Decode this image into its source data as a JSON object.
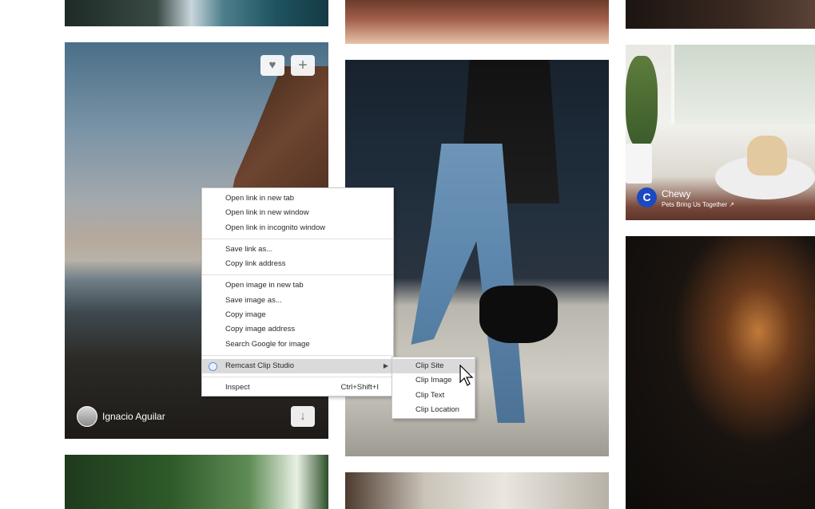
{
  "gallery": {
    "photo_author": "Ignacio Aguilar",
    "like_icon": "heart-icon",
    "add_icon": "plus-icon",
    "download_icon": "download-arrow-icon"
  },
  "ad": {
    "logo_letter": "C",
    "brand": "Chewy",
    "tagline": "Pets Bring Us Together ↗",
    "brand_color": "#1c49c2"
  },
  "context_menu": {
    "group1": [
      "Open link in new tab",
      "Open link in new window",
      "Open link in incognito window"
    ],
    "group2": [
      "Save link as...",
      "Copy link address"
    ],
    "group3": [
      "Open image in new tab",
      "Save image as...",
      "Copy image",
      "Copy image address",
      "Search Google for image"
    ],
    "extension_item": "Remcast Clip Studio",
    "inspect": "Inspect",
    "inspect_shortcut": "Ctrl+Shift+I",
    "highlight_color": "#dadada"
  },
  "submenu": {
    "items": [
      "Clip Site",
      "Clip Image",
      "Clip Text",
      "Clip Location"
    ],
    "highlighted": "Clip Site"
  }
}
